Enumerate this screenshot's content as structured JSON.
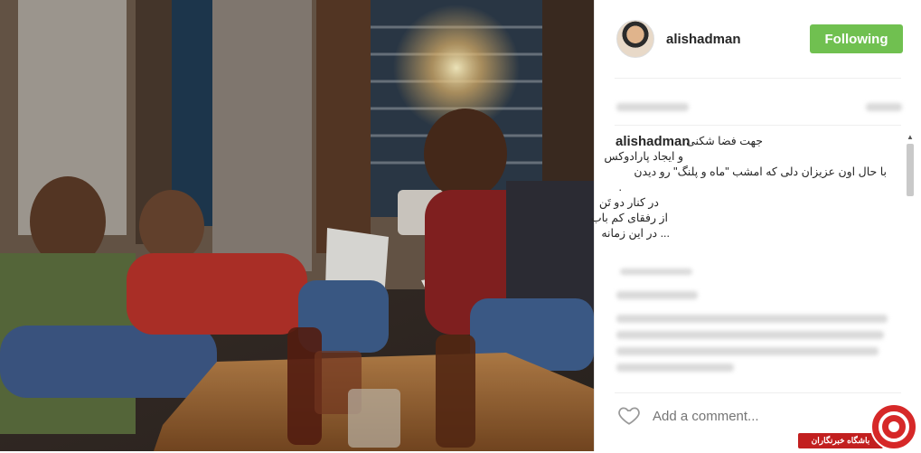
{
  "post": {
    "username": "alishadman",
    "follow_label": "Following",
    "caption_user": "alishadman",
    "caption_lines": [
      "جهت فضا شکنی",
      "و ایجاد پارادوکس",
      "با حال اون عزیزان دلی که امشب \"ماه و پلنگ\" رو دیدن",
      ".",
      "در کنار دو تَن",
      "از رفقای کم باب",
      "... در این زمانه"
    ],
    "comment_placeholder": "Add a comment..."
  },
  "watermark": {
    "text": "باشگاه خبرنگاران"
  },
  "colors": {
    "follow_bg": "#70c050",
    "watermark_red": "#d62828"
  }
}
